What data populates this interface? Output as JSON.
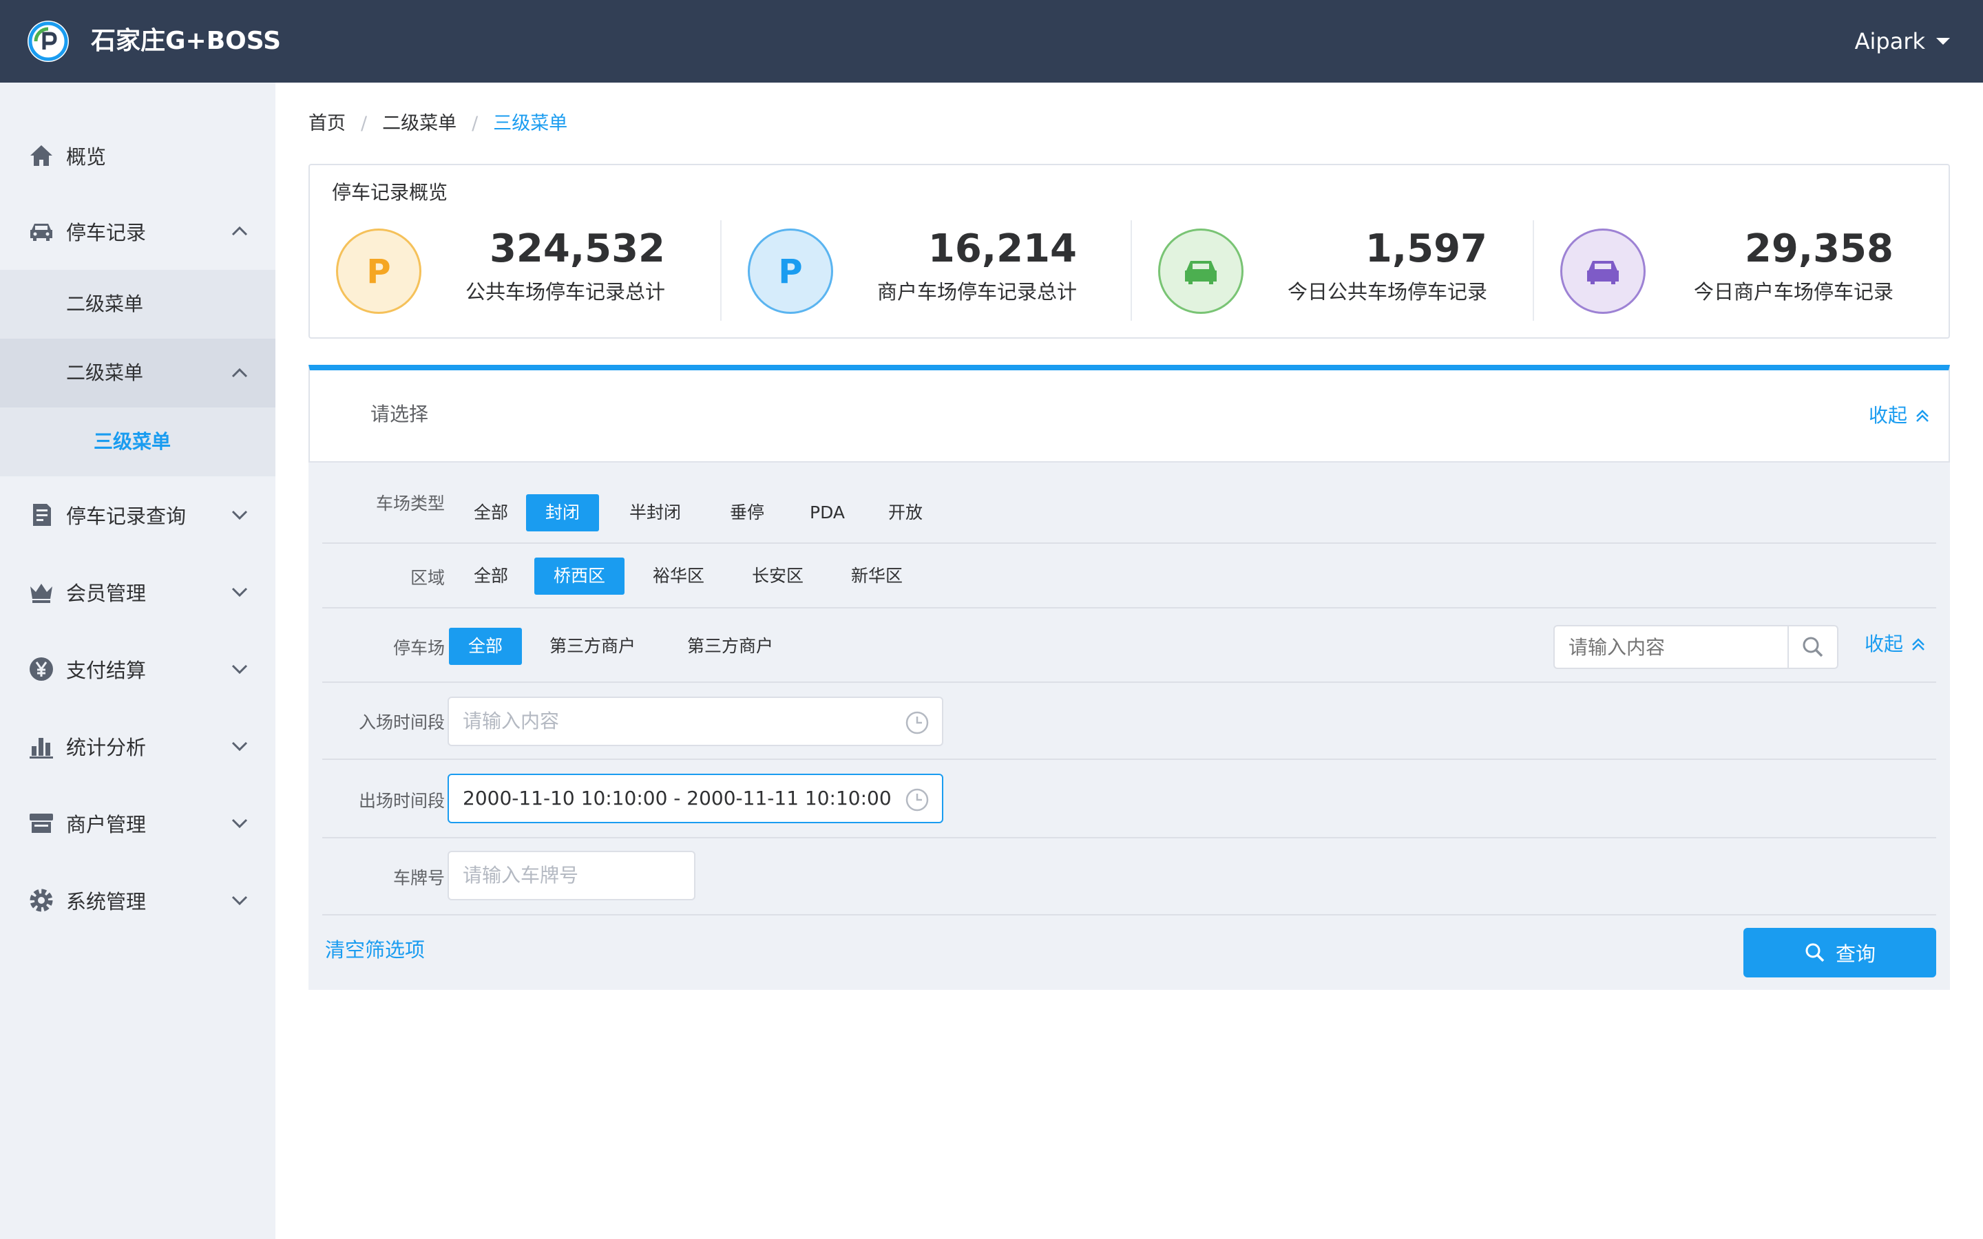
{
  "header": {
    "app_title": "石家庄G+BOSS",
    "user_name": "Aipark",
    "brand_color": "#323f55",
    "accent_color": "#1a9cf0"
  },
  "sidebar": {
    "items": [
      {
        "label": "概览",
        "icon": "home-icon"
      },
      {
        "label": "停车记录",
        "icon": "car-icon",
        "expanded": true
      },
      {
        "label": "二级菜单"
      },
      {
        "label": "二级菜单",
        "expanded": true
      },
      {
        "label": "三级菜单",
        "active": true
      },
      {
        "label": "停车记录查询",
        "icon": "document-icon"
      },
      {
        "label": "会员管理",
        "icon": "crown-icon"
      },
      {
        "label": "支付结算",
        "icon": "yen-icon"
      },
      {
        "label": "统计分析",
        "icon": "bar-chart-icon"
      },
      {
        "label": "商户管理",
        "icon": "store-icon"
      },
      {
        "label": "系统管理",
        "icon": "settings-icon"
      }
    ]
  },
  "breadcrumb": {
    "items": [
      "首页",
      "二级菜单",
      "三级菜单"
    ],
    "separator": "/"
  },
  "overview": {
    "title": "停车记录概览",
    "stats": [
      {
        "value": "324,532",
        "label": "公共车场停车记录总计",
        "icon": "parking-p-icon",
        "color": "#f5a623"
      },
      {
        "value": "16,214",
        "label": "商户车场停车记录总计",
        "icon": "parking-p-icon",
        "color": "#1a9cf0"
      },
      {
        "value": "1,597",
        "label": "今日公共车场停车记录",
        "icon": "car-icon",
        "color": "#4caf50"
      },
      {
        "value": "29,358",
        "label": "今日商户车场停车记录",
        "icon": "car-icon",
        "color": "#7e5bc7"
      }
    ]
  },
  "filter": {
    "title": "请选择",
    "collapse_label": "收起",
    "rows": {
      "lot_type": {
        "label": "车场类型",
        "options": [
          "全部",
          "封闭",
          "半封闭",
          "垂停",
          "PDA",
          "开放"
        ],
        "selected": "封闭"
      },
      "district": {
        "label": "区域",
        "options": [
          "全部",
          "桥西区",
          "裕华区",
          "长安区",
          "新华区"
        ],
        "selected": "桥西区"
      },
      "parking_lot": {
        "label": "停车场",
        "options": [
          "全部",
          "第三方商户",
          "第三方商户"
        ],
        "selected": "全部",
        "search_placeholder": "请输入内容",
        "collapse_label": "收起"
      },
      "entry_time": {
        "label": "入场时间段",
        "placeholder": "请输入内容"
      },
      "exit_time": {
        "label": "出场时间段",
        "value": "2000-11-10 10:10:00 - 2000-11-11 10:10:00"
      },
      "plate": {
        "label": "车牌号",
        "placeholder": "请输入车牌号"
      }
    },
    "clear_label": "清空筛选项",
    "query_label": "查询"
  }
}
